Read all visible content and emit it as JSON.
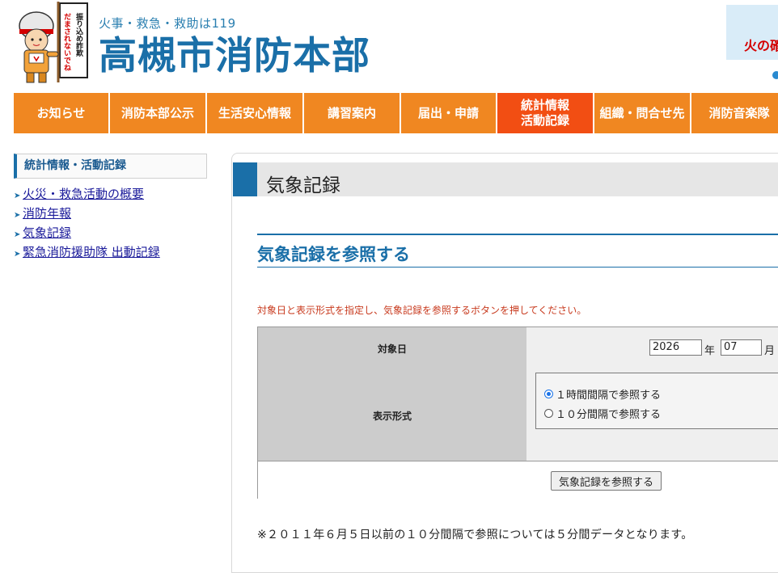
{
  "header": {
    "tagline": "火事・救急・救助は119",
    "site_title": "高槻市消防本部",
    "mascot_sign": "振り込め詐欺 だまされないでね",
    "banner_text": "火の確"
  },
  "nav": {
    "items": [
      {
        "label": "お知らせ"
      },
      {
        "label": "消防本部公示"
      },
      {
        "label": "生活安心情報"
      },
      {
        "label": "講習案内"
      },
      {
        "label": "届出・申請"
      },
      {
        "label": "統計情報\n活動記録",
        "active": true
      },
      {
        "label": "組織・問合せ先"
      },
      {
        "label": "消防音楽隊"
      }
    ]
  },
  "sidebar": {
    "heading": "統計情報・活動記録",
    "links": [
      {
        "label": "火災・救急活動の概要"
      },
      {
        "label": "消防年報"
      },
      {
        "label": "気象記録"
      },
      {
        "label": "緊急消防援助隊 出動記録"
      }
    ]
  },
  "main": {
    "page_title": "気象記録",
    "section_title": "気象記録を参照する",
    "instruction": "対象日と表示形式を指定し、気象記録を参照するボタンを押してください。",
    "form": {
      "date_label": "対象日",
      "year_value": "2026",
      "year_unit": "年",
      "month_value": "07",
      "month_unit": "月",
      "format_label": "表示形式",
      "options": [
        {
          "label": "１時間間隔で参照する",
          "checked": true
        },
        {
          "label": "１０分間隔で参照する",
          "checked": false
        }
      ],
      "submit_label": "気象記録を参照する"
    },
    "note": "※２０１１年６月５日以前の１０分間隔で参照については５分間データとなります。"
  },
  "colors": {
    "nav_orange": "#f08721",
    "nav_active": "#f24e13",
    "brand_blue": "#1a6fa8",
    "instruction_red": "#c83a1e"
  }
}
